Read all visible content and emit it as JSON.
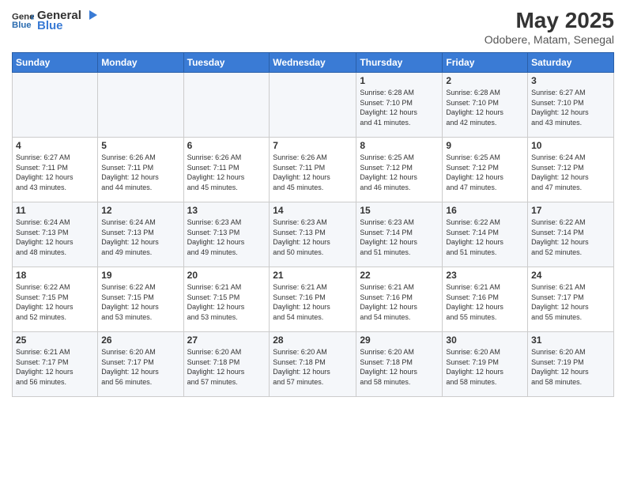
{
  "logo": {
    "general": "General",
    "blue": "Blue"
  },
  "header": {
    "month": "May 2025",
    "location": "Odobere, Matam, Senegal"
  },
  "days_of_week": [
    "Sunday",
    "Monday",
    "Tuesday",
    "Wednesday",
    "Thursday",
    "Friday",
    "Saturday"
  ],
  "weeks": [
    [
      {
        "day": "",
        "info": ""
      },
      {
        "day": "",
        "info": ""
      },
      {
        "day": "",
        "info": ""
      },
      {
        "day": "",
        "info": ""
      },
      {
        "day": "1",
        "info": "Sunrise: 6:28 AM\nSunset: 7:10 PM\nDaylight: 12 hours\nand 41 minutes."
      },
      {
        "day": "2",
        "info": "Sunrise: 6:28 AM\nSunset: 7:10 PM\nDaylight: 12 hours\nand 42 minutes."
      },
      {
        "day": "3",
        "info": "Sunrise: 6:27 AM\nSunset: 7:10 PM\nDaylight: 12 hours\nand 43 minutes."
      }
    ],
    [
      {
        "day": "4",
        "info": "Sunrise: 6:27 AM\nSunset: 7:11 PM\nDaylight: 12 hours\nand 43 minutes."
      },
      {
        "day": "5",
        "info": "Sunrise: 6:26 AM\nSunset: 7:11 PM\nDaylight: 12 hours\nand 44 minutes."
      },
      {
        "day": "6",
        "info": "Sunrise: 6:26 AM\nSunset: 7:11 PM\nDaylight: 12 hours\nand 45 minutes."
      },
      {
        "day": "7",
        "info": "Sunrise: 6:26 AM\nSunset: 7:11 PM\nDaylight: 12 hours\nand 45 minutes."
      },
      {
        "day": "8",
        "info": "Sunrise: 6:25 AM\nSunset: 7:12 PM\nDaylight: 12 hours\nand 46 minutes."
      },
      {
        "day": "9",
        "info": "Sunrise: 6:25 AM\nSunset: 7:12 PM\nDaylight: 12 hours\nand 47 minutes."
      },
      {
        "day": "10",
        "info": "Sunrise: 6:24 AM\nSunset: 7:12 PM\nDaylight: 12 hours\nand 47 minutes."
      }
    ],
    [
      {
        "day": "11",
        "info": "Sunrise: 6:24 AM\nSunset: 7:13 PM\nDaylight: 12 hours\nand 48 minutes."
      },
      {
        "day": "12",
        "info": "Sunrise: 6:24 AM\nSunset: 7:13 PM\nDaylight: 12 hours\nand 49 minutes."
      },
      {
        "day": "13",
        "info": "Sunrise: 6:23 AM\nSunset: 7:13 PM\nDaylight: 12 hours\nand 49 minutes."
      },
      {
        "day": "14",
        "info": "Sunrise: 6:23 AM\nSunset: 7:13 PM\nDaylight: 12 hours\nand 50 minutes."
      },
      {
        "day": "15",
        "info": "Sunrise: 6:23 AM\nSunset: 7:14 PM\nDaylight: 12 hours\nand 51 minutes."
      },
      {
        "day": "16",
        "info": "Sunrise: 6:22 AM\nSunset: 7:14 PM\nDaylight: 12 hours\nand 51 minutes."
      },
      {
        "day": "17",
        "info": "Sunrise: 6:22 AM\nSunset: 7:14 PM\nDaylight: 12 hours\nand 52 minutes."
      }
    ],
    [
      {
        "day": "18",
        "info": "Sunrise: 6:22 AM\nSunset: 7:15 PM\nDaylight: 12 hours\nand 52 minutes."
      },
      {
        "day": "19",
        "info": "Sunrise: 6:22 AM\nSunset: 7:15 PM\nDaylight: 12 hours\nand 53 minutes."
      },
      {
        "day": "20",
        "info": "Sunrise: 6:21 AM\nSunset: 7:15 PM\nDaylight: 12 hours\nand 53 minutes."
      },
      {
        "day": "21",
        "info": "Sunrise: 6:21 AM\nSunset: 7:16 PM\nDaylight: 12 hours\nand 54 minutes."
      },
      {
        "day": "22",
        "info": "Sunrise: 6:21 AM\nSunset: 7:16 PM\nDaylight: 12 hours\nand 54 minutes."
      },
      {
        "day": "23",
        "info": "Sunrise: 6:21 AM\nSunset: 7:16 PM\nDaylight: 12 hours\nand 55 minutes."
      },
      {
        "day": "24",
        "info": "Sunrise: 6:21 AM\nSunset: 7:17 PM\nDaylight: 12 hours\nand 55 minutes."
      }
    ],
    [
      {
        "day": "25",
        "info": "Sunrise: 6:21 AM\nSunset: 7:17 PM\nDaylight: 12 hours\nand 56 minutes."
      },
      {
        "day": "26",
        "info": "Sunrise: 6:20 AM\nSunset: 7:17 PM\nDaylight: 12 hours\nand 56 minutes."
      },
      {
        "day": "27",
        "info": "Sunrise: 6:20 AM\nSunset: 7:18 PM\nDaylight: 12 hours\nand 57 minutes."
      },
      {
        "day": "28",
        "info": "Sunrise: 6:20 AM\nSunset: 7:18 PM\nDaylight: 12 hours\nand 57 minutes."
      },
      {
        "day": "29",
        "info": "Sunrise: 6:20 AM\nSunset: 7:18 PM\nDaylight: 12 hours\nand 58 minutes."
      },
      {
        "day": "30",
        "info": "Sunrise: 6:20 AM\nSunset: 7:19 PM\nDaylight: 12 hours\nand 58 minutes."
      },
      {
        "day": "31",
        "info": "Sunrise: 6:20 AM\nSunset: 7:19 PM\nDaylight: 12 hours\nand 58 minutes."
      }
    ]
  ]
}
